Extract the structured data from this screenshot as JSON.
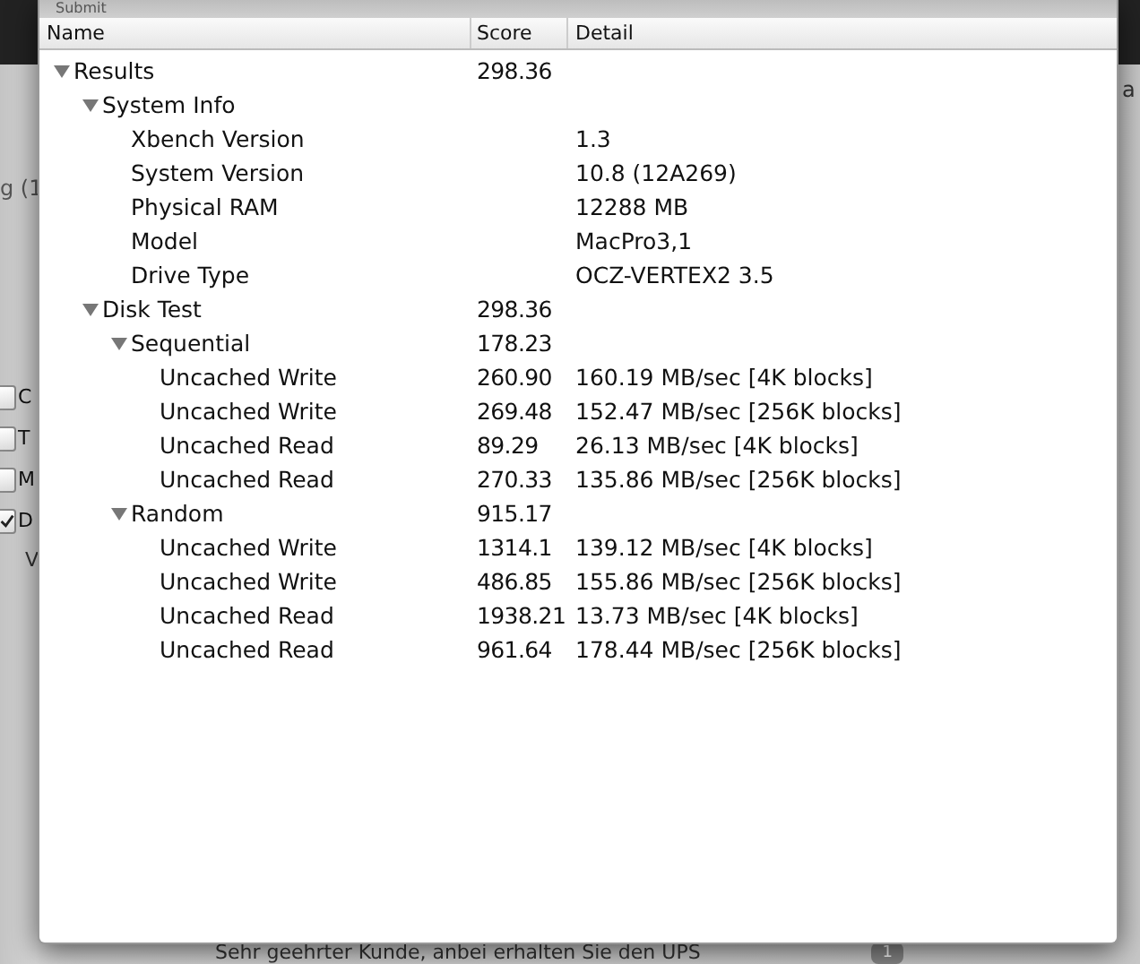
{
  "window": {
    "title": "Submit"
  },
  "background": {
    "left_text": "g (1",
    "checkboxes": [
      {
        "label": "C",
        "checked": false
      },
      {
        "label": "T",
        "checked": false
      },
      {
        "label": "M",
        "checked": false
      },
      {
        "label": "D",
        "checked": true
      }
    ],
    "left_label": "V",
    "right_text": "a",
    "message_preview": "Sehr geehrter Kunde, anbei erhalten Sie den UPS",
    "message_badge": "1"
  },
  "table": {
    "columns": [
      "Name",
      "Score",
      "Detail"
    ],
    "rows": [
      {
        "name": "Results",
        "score": "298.36",
        "expanded": true,
        "children": [
          {
            "name": "System Info",
            "expanded": true,
            "children": [
              {
                "name": "Xbench Version",
                "detail": "1.3"
              },
              {
                "name": "System Version",
                "detail": "10.8 (12A269)"
              },
              {
                "name": "Physical RAM",
                "detail": "12288 MB"
              },
              {
                "name": "Model",
                "detail": "MacPro3,1"
              },
              {
                "name": "Drive Type",
                "detail": "OCZ-VERTEX2 3.5"
              }
            ]
          },
          {
            "name": "Disk Test",
            "score": "298.36",
            "expanded": true,
            "children": [
              {
                "name": "Sequential",
                "score": "178.23",
                "expanded": true,
                "children": [
                  {
                    "name": "Uncached Write",
                    "score": "260.90",
                    "detail": "160.19 MB/sec [4K blocks]"
                  },
                  {
                    "name": "Uncached Write",
                    "score": "269.48",
                    "detail": "152.47 MB/sec [256K blocks]"
                  },
                  {
                    "name": "Uncached Read",
                    "score": "89.29",
                    "detail": "26.13 MB/sec [4K blocks]"
                  },
                  {
                    "name": "Uncached Read",
                    "score": "270.33",
                    "detail": "135.86 MB/sec [256K blocks]"
                  }
                ]
              },
              {
                "name": "Random",
                "score": "915.17",
                "expanded": true,
                "children": [
                  {
                    "name": "Uncached Write",
                    "score": "1314.1",
                    "detail": "139.12 MB/sec [4K blocks]"
                  },
                  {
                    "name": "Uncached Write",
                    "score": "486.85",
                    "detail": "155.86 MB/sec [256K blocks]"
                  },
                  {
                    "name": "Uncached Read",
                    "score": "1938.21",
                    "detail": "13.73 MB/sec [4K blocks]"
                  },
                  {
                    "name": "Uncached Read",
                    "score": "961.64",
                    "detail": "178.44 MB/sec [256K blocks]"
                  }
                ]
              }
            ]
          }
        ]
      }
    ]
  }
}
